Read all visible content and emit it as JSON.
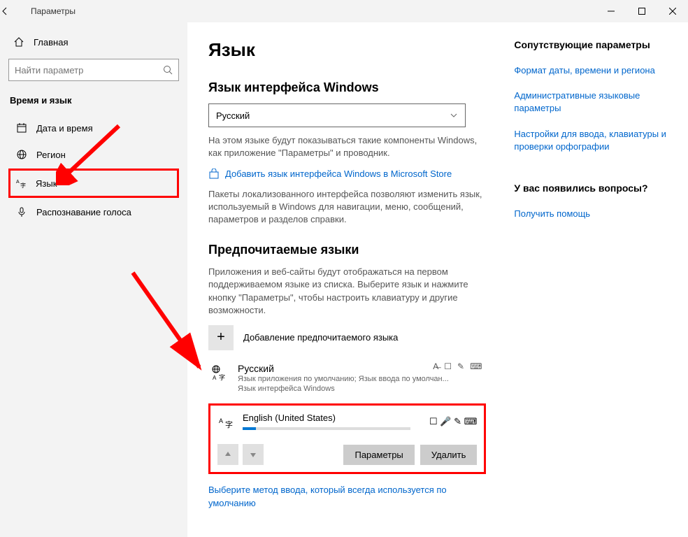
{
  "titlebar": {
    "title": "Параметры"
  },
  "sidebar": {
    "home": "Главная",
    "search_placeholder": "Найти параметр",
    "section": "Время и язык",
    "items": [
      {
        "label": "Дата и время"
      },
      {
        "label": "Регион"
      },
      {
        "label": "Язык"
      },
      {
        "label": "Распознавание голоса"
      }
    ]
  },
  "main": {
    "title": "Язык",
    "display_lang_heading": "Язык интерфейса Windows",
    "display_lang_value": "Русский",
    "display_lang_desc": "На этом языке будут показываться такие компоненты Windows, как приложение \"Параметры\" и проводник.",
    "add_display_link": "Добавить язык интерфейса Windows в Microsoft Store",
    "packs_desc": "Пакеты локализованного интерфейса позволяют изменить язык, используемый в Windows для навигации, меню, сообщений, параметров и разделов справки.",
    "pref_heading": "Предпочитаемые языки",
    "pref_desc": "Приложения и веб-сайты будут отображаться на первом поддерживаемом языке из списка. Выберите язык и нажмите кнопку \"Параметры\", чтобы настроить клавиатуру и другие возможности.",
    "add_pref": "Добавление предпочитаемого языка",
    "lang1": {
      "name": "Русский",
      "sub1": "Язык приложения по умолчанию; Язык ввода по умолчан...",
      "sub2": "Язык интерфейса Windows"
    },
    "lang2": {
      "name": "English (United States)"
    },
    "btn_options": "Параметры",
    "btn_remove": "Удалить",
    "default_input_link": "Выберите метод ввода, который всегда используется по умолчанию"
  },
  "aside": {
    "related_heading": "Сопутствующие параметры",
    "link1": "Формат даты, времени и региона",
    "link2": "Административные языковые параметры",
    "link3": "Настройки для ввода, клавиатуры и проверки орфографии",
    "help_heading": "У вас появились вопросы?",
    "help_link": "Получить помощь"
  }
}
